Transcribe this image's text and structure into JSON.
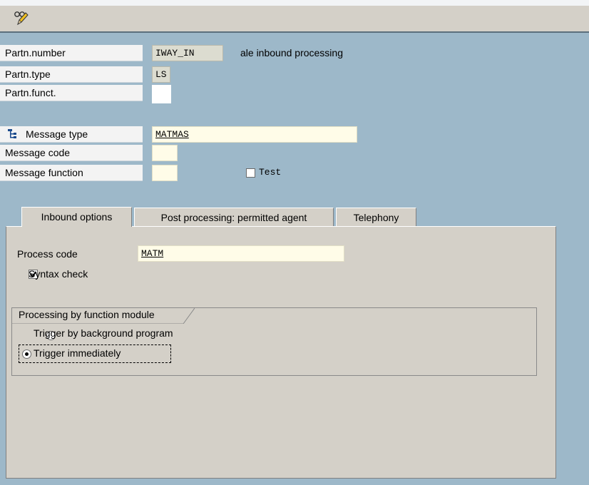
{
  "header": {
    "partner_number_label": "Partn.number",
    "partner_number_value": "IWAY_IN",
    "partner_number_desc": "ale inbound processing",
    "partner_type_label": "Partn.type",
    "partner_type_value": "LS",
    "partner_function_label": "Partn.funct.",
    "partner_function_value": ""
  },
  "message": {
    "message_type_label": "Message type",
    "message_type_value": "MATMAS",
    "message_code_label": "Message code",
    "message_code_value": "",
    "message_function_label": "Message function",
    "message_function_value": "",
    "test_label": "Test",
    "test_checked": false
  },
  "tabs": [
    {
      "label": "Inbound options",
      "active": true
    },
    {
      "label": "Post processing: permitted agent",
      "active": false
    },
    {
      "label": "Telephony",
      "active": false
    }
  ],
  "inbound": {
    "process_code_label": "Process code",
    "process_code_value": "MATM",
    "syntax_check_label": "Syntax check",
    "syntax_check_checked": true,
    "group_title": "Processing by function module",
    "radio_background_label": "Trigger by background program",
    "radio_immediately_label": "Trigger immediately",
    "selected": "immediately"
  },
  "icons": {
    "toolbar": "display-change-icon",
    "message_type": "hierarchy-icon"
  }
}
